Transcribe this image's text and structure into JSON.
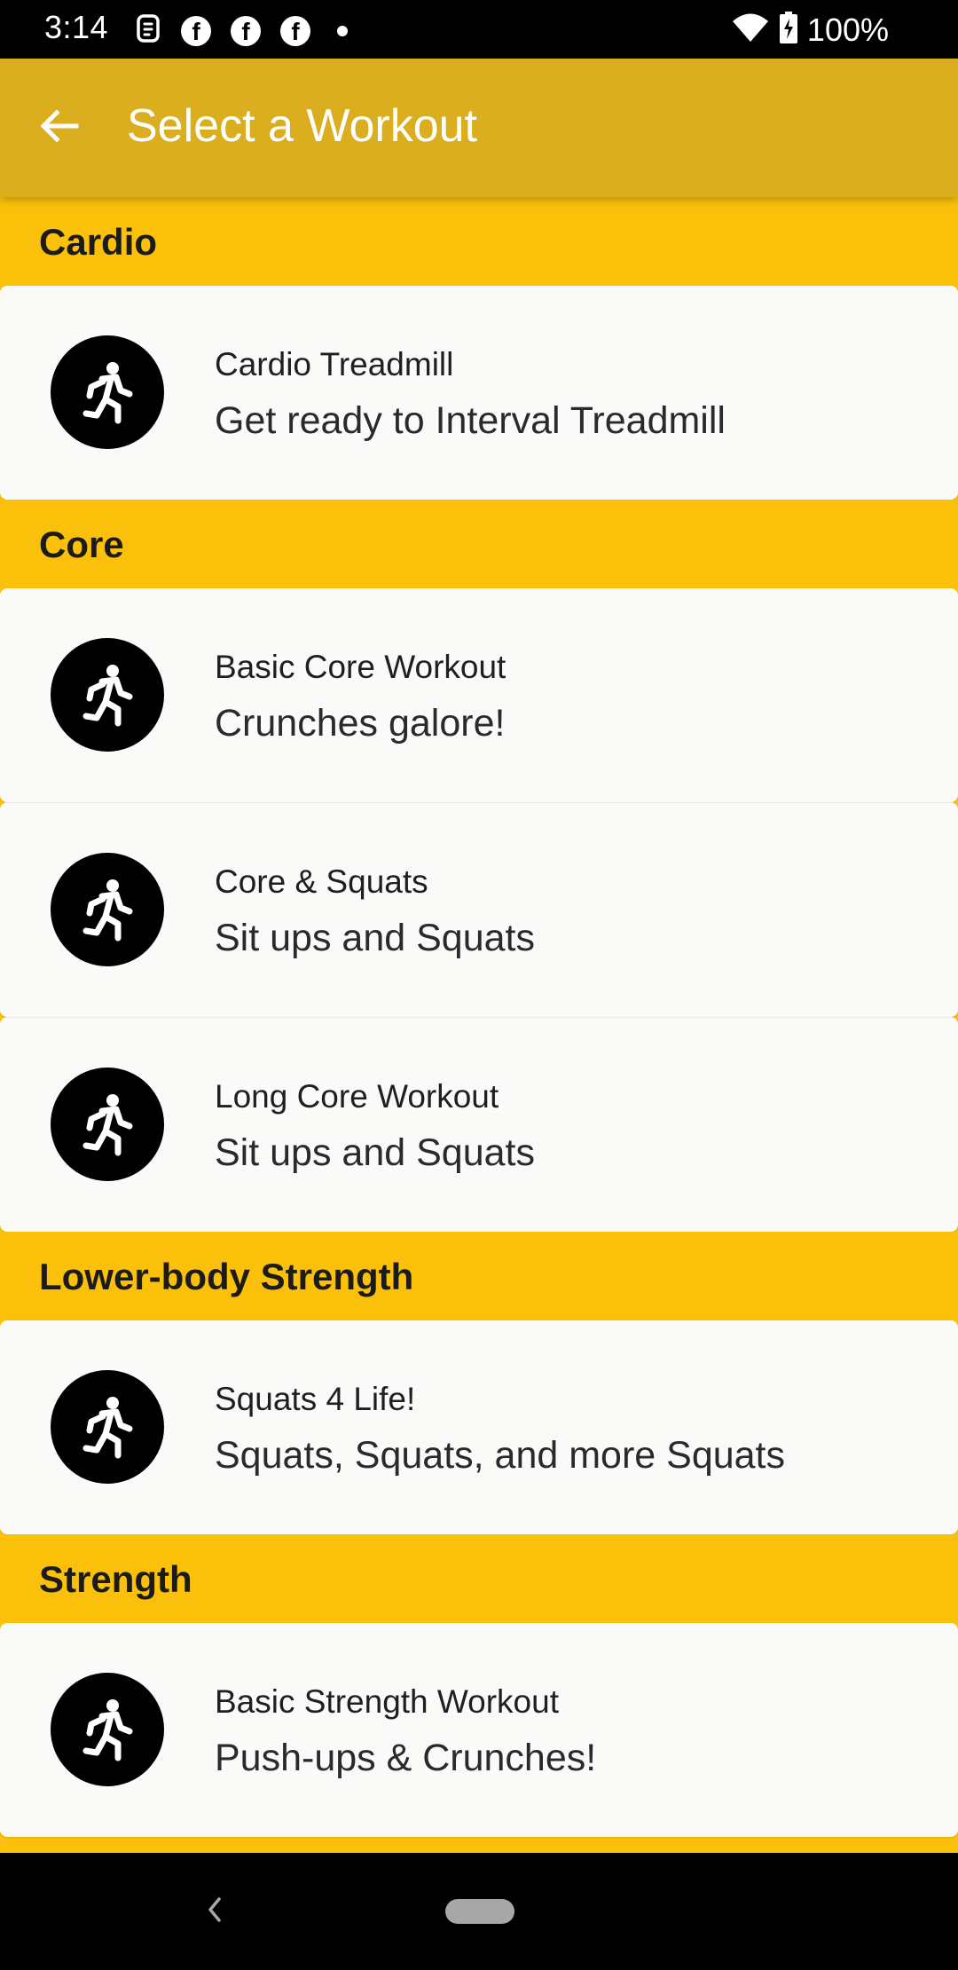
{
  "status_bar": {
    "time": "3:14",
    "battery_text": "100%",
    "left_icons": [
      "alarm-icon",
      "facebook-icon",
      "facebook-icon",
      "facebook-icon",
      "dot-icon"
    ],
    "right_icons": [
      "wifi-icon",
      "battery-charging-icon"
    ]
  },
  "app_bar": {
    "title": "Select a Workout",
    "back_icon": "arrow-back-icon",
    "color": "#daae1e"
  },
  "theme": {
    "section_color": "#fbc10a",
    "card_color": "#fafaf8",
    "icon_background": "#000000"
  },
  "sections": [
    {
      "title": "Cardio",
      "items": [
        {
          "title": "Cardio Treadmill",
          "subtitle": "Get ready to Interval Treadmill",
          "icon": "running-person-icon"
        }
      ]
    },
    {
      "title": "Core",
      "items": [
        {
          "title": "Basic Core Workout",
          "subtitle": "Crunches galore!",
          "icon": "running-person-icon"
        },
        {
          "title": "Core & Squats",
          "subtitle": "Sit ups and Squats",
          "icon": "running-person-icon"
        },
        {
          "title": "Long Core Workout",
          "subtitle": "Sit ups and Squats",
          "icon": "running-person-icon"
        }
      ]
    },
    {
      "title": "Lower-body Strength",
      "items": [
        {
          "title": "Squats 4 Life!",
          "subtitle": "Squats, Squats, and more Squats",
          "icon": "running-person-icon"
        }
      ]
    },
    {
      "title": "Strength",
      "items": [
        {
          "title": "Basic Strength Workout",
          "subtitle": "Push-ups & Crunches!",
          "icon": "running-person-icon"
        }
      ]
    }
  ],
  "nav_bar": {
    "back_icon": "nav-back-icon",
    "home_icon": "home-pill-icon"
  }
}
